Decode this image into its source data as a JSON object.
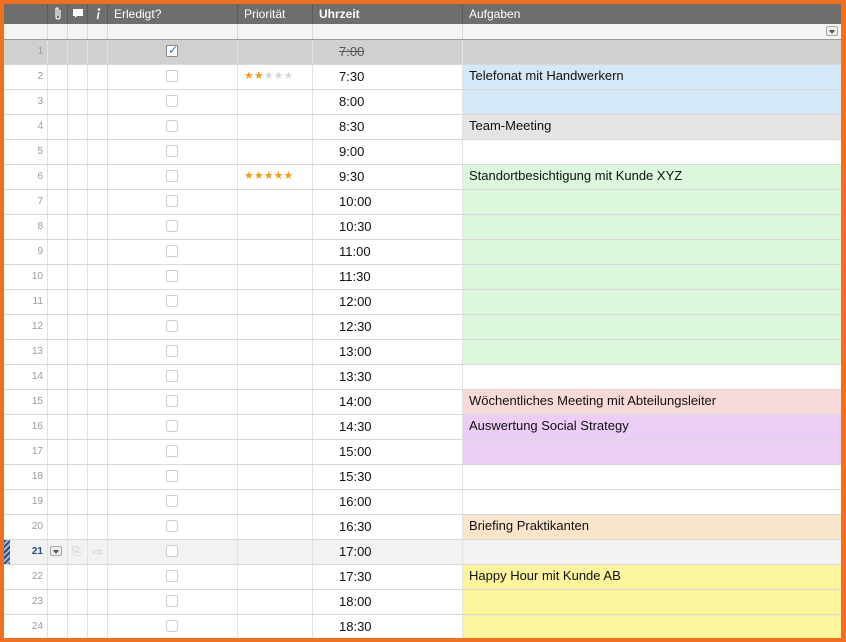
{
  "header": {
    "col_attach_icon": "paperclip-icon",
    "col_comment_icon": "comment-icon",
    "col_info_icon": "info-icon",
    "col_done": "Erledigt?",
    "col_priority": "Priorität",
    "col_time": "Uhrzeit",
    "col_tasks": "Aufgaben"
  },
  "colors": {
    "frame": "#f07020",
    "header_bg": "#6e6e6e",
    "blue": "#d5e8f7",
    "grey": "#e4e4e4",
    "green": "#dcf7dc",
    "red": "#f7d9d9",
    "purple": "#ebcdf5",
    "orange": "#f9e5c9",
    "yellow": "#fbf59e",
    "selected": "#d0d0d0"
  },
  "rows": [
    {
      "num": "1",
      "done": true,
      "stars": 0,
      "time": "7:00",
      "task": "",
      "color": "selected",
      "strike": true
    },
    {
      "num": "2",
      "done": false,
      "stars": 2,
      "time": "7:30",
      "task": "Telefonat mit Handwerkern",
      "color": "blue"
    },
    {
      "num": "3",
      "done": false,
      "stars": 0,
      "time": "8:00",
      "task": "",
      "color": "blue"
    },
    {
      "num": "4",
      "done": false,
      "stars": 0,
      "time": "8:30",
      "task": "Team-Meeting",
      "color": "grey"
    },
    {
      "num": "5",
      "done": false,
      "stars": 0,
      "time": "9:00",
      "task": "",
      "color": ""
    },
    {
      "num": "6",
      "done": false,
      "stars": 5,
      "time": "9:30",
      "task": "Standortbesichtigung mit Kunde XYZ",
      "color": "green"
    },
    {
      "num": "7",
      "done": false,
      "stars": 0,
      "time": "10:00",
      "task": "",
      "color": "green"
    },
    {
      "num": "8",
      "done": false,
      "stars": 0,
      "time": "10:30",
      "task": "",
      "color": "green"
    },
    {
      "num": "9",
      "done": false,
      "stars": 0,
      "time": "11:00",
      "task": "",
      "color": "green"
    },
    {
      "num": "10",
      "done": false,
      "stars": 0,
      "time": "11:30",
      "task": "",
      "color": "green"
    },
    {
      "num": "11",
      "done": false,
      "stars": 0,
      "time": "12:00",
      "task": "",
      "color": "green"
    },
    {
      "num": "12",
      "done": false,
      "stars": 0,
      "time": "12:30",
      "task": "",
      "color": "green"
    },
    {
      "num": "13",
      "done": false,
      "stars": 0,
      "time": "13:00",
      "task": "",
      "color": "green"
    },
    {
      "num": "14",
      "done": false,
      "stars": 0,
      "time": "13:30",
      "task": "",
      "color": ""
    },
    {
      "num": "15",
      "done": false,
      "stars": 0,
      "time": "14:00",
      "task": "Wöchentliches Meeting mit Abteilungsleiter",
      "color": "red"
    },
    {
      "num": "16",
      "done": false,
      "stars": 0,
      "time": "14:30",
      "task": "Auswertung Social Strategy",
      "color": "purple"
    },
    {
      "num": "17",
      "done": false,
      "stars": 0,
      "time": "15:00",
      "task": "",
      "color": "purple"
    },
    {
      "num": "18",
      "done": false,
      "stars": 0,
      "time": "15:30",
      "task": "",
      "color": ""
    },
    {
      "num": "19",
      "done": false,
      "stars": 0,
      "time": "16:00",
      "task": "",
      "color": ""
    },
    {
      "num": "20",
      "done": false,
      "stars": 0,
      "time": "16:30",
      "task": "Briefing Praktikanten",
      "color": "orange"
    },
    {
      "num": "21",
      "done": false,
      "stars": 0,
      "time": "17:00",
      "task": "",
      "color": "",
      "active": true
    },
    {
      "num": "22",
      "done": false,
      "stars": 0,
      "time": "17:30",
      "task": "Happy Hour mit Kunde AB",
      "color": "yellow"
    },
    {
      "num": "23",
      "done": false,
      "stars": 0,
      "time": "18:00",
      "task": "",
      "color": "yellow"
    },
    {
      "num": "24",
      "done": false,
      "stars": 0,
      "time": "18:30",
      "task": "",
      "color": "yellow"
    }
  ]
}
